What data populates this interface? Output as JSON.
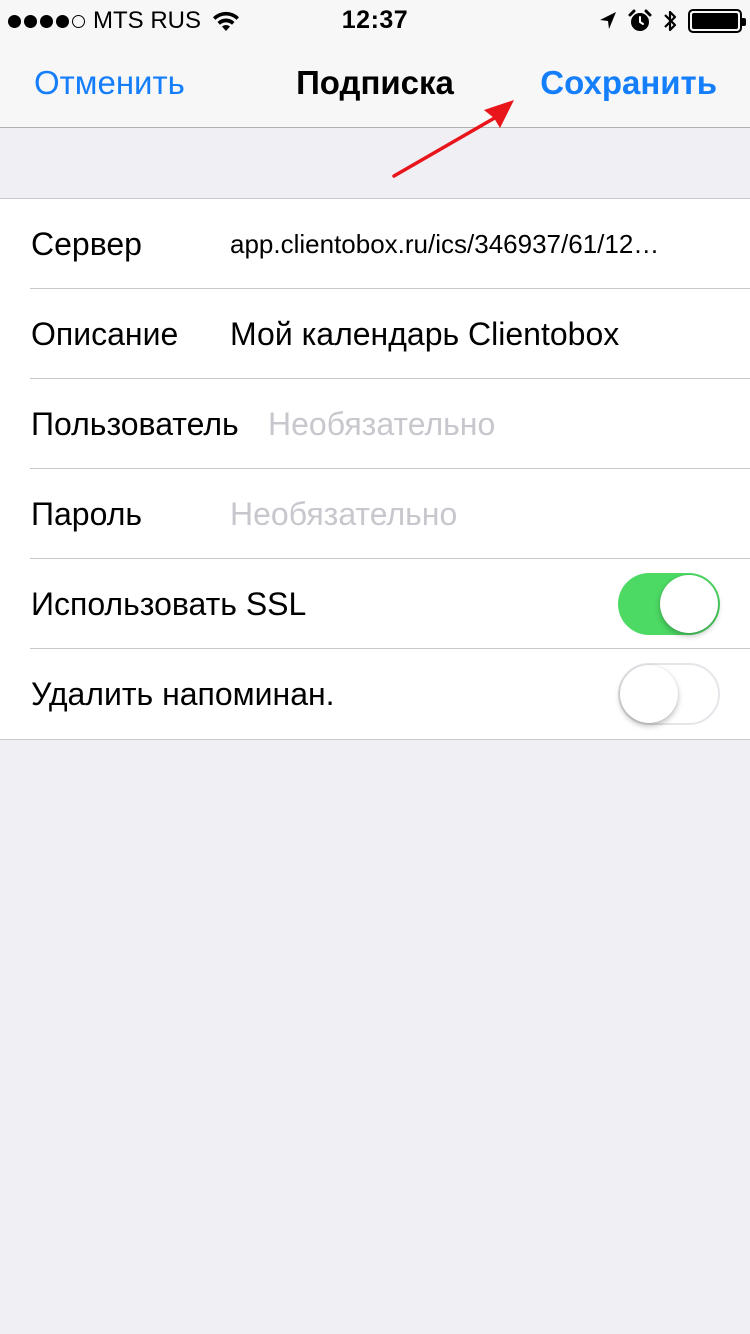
{
  "status_bar": {
    "carrier": "MTS RUS",
    "time": "12:37",
    "signal_bars": 4,
    "signal_total": 5,
    "icons": [
      "wifi-icon",
      "location-arrow-icon",
      "alarm-icon",
      "bluetooth-icon",
      "battery-icon"
    ]
  },
  "nav": {
    "cancel_label": "Отменить",
    "title": "Подписка",
    "save_label": "Сохранить"
  },
  "form": {
    "server": {
      "label": "Сервер",
      "value": "app.clientobox.ru/ics/346937/61/12…"
    },
    "description": {
      "label": "Описание",
      "value": "Мой календарь Clientobox"
    },
    "user": {
      "label": "Пользователь",
      "placeholder": "Необязательно",
      "value": ""
    },
    "password": {
      "label": "Пароль",
      "placeholder": "Необязательно",
      "value": ""
    },
    "ssl": {
      "label": "Использовать SSL",
      "on": true
    },
    "remove_alerts": {
      "label": "Удалить напоминан.",
      "on": false
    }
  },
  "colors": {
    "accent": "#147efb",
    "switch_on": "#4cd964",
    "background": "#efeff4",
    "annotation_arrow": "#e8151b"
  }
}
